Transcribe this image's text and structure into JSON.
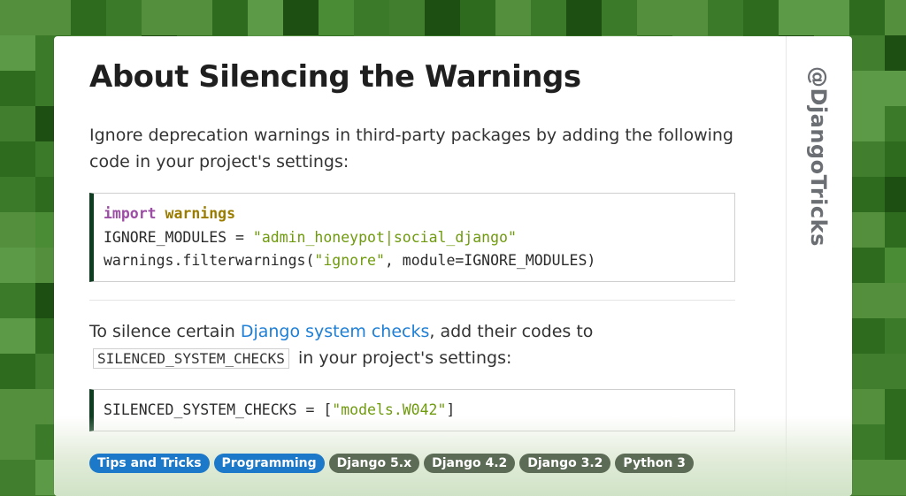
{
  "brand": "@DjangoTricks",
  "title": "About Silencing the Warnings",
  "para1": "Ignore deprecation warnings in third-party packages by adding the following code in your project's settings:",
  "code1": {
    "line1_kw": "import",
    "line1_mod": "warnings",
    "line2_pre": "IGNORE_MODULES = ",
    "line2_str": "\"admin_honeypot|social_django\"",
    "line3_pre": "warnings.filterwarnings(",
    "line3_str": "\"ignore\"",
    "line3_post": ", module=IGNORE_MODULES)"
  },
  "para2": {
    "before": "To silence certain ",
    "link": "Django system checks",
    "after": ", add their codes to",
    "code": "SILENCED_SYSTEM_CHECKS",
    "end": "in your project's settings:"
  },
  "code2": {
    "pre": "SILENCED_SYSTEM_CHECKS = [",
    "str": "\"models.W042\"",
    "post": "]"
  },
  "tags": [
    {
      "label": "Tips and Tricks",
      "color": "#1c78c8"
    },
    {
      "label": "Programming",
      "color": "#1c78c8"
    },
    {
      "label": "Django 5.x",
      "color": "#5c6b55"
    },
    {
      "label": "Django 4.2",
      "color": "#5c6b55"
    },
    {
      "label": "Django 3.2",
      "color": "#5c6b55"
    },
    {
      "label": "Python 3",
      "color": "#5c6b55"
    }
  ]
}
